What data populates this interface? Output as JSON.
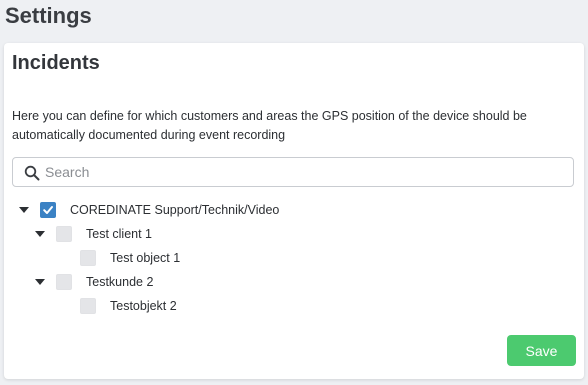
{
  "page": {
    "title": "Settings"
  },
  "incidents": {
    "title": "Incidents",
    "description": "Here you can define for which customers and areas the GPS position of the device should be automatically documented during event recording",
    "search": {
      "placeholder": "Search",
      "value": ""
    },
    "tree": [
      {
        "label": "COREDINATE Support/Technik/Video",
        "checked": true,
        "expanded": true,
        "icon": "caret-down-icon"
      },
      {
        "label": "Test client 1",
        "checked": false,
        "expanded": true,
        "icon": "caret-down-icon"
      },
      {
        "label": "Test object 1",
        "checked": false
      },
      {
        "label": "Testkunde 2",
        "checked": false,
        "expanded": true,
        "icon": "caret-down-icon"
      },
      {
        "label": "Testobjekt 2",
        "checked": false
      }
    ],
    "save_label": "Save"
  },
  "colors": {
    "accent": "#3b82c4",
    "save": "#4cca6f",
    "background": "#eef0f3"
  }
}
